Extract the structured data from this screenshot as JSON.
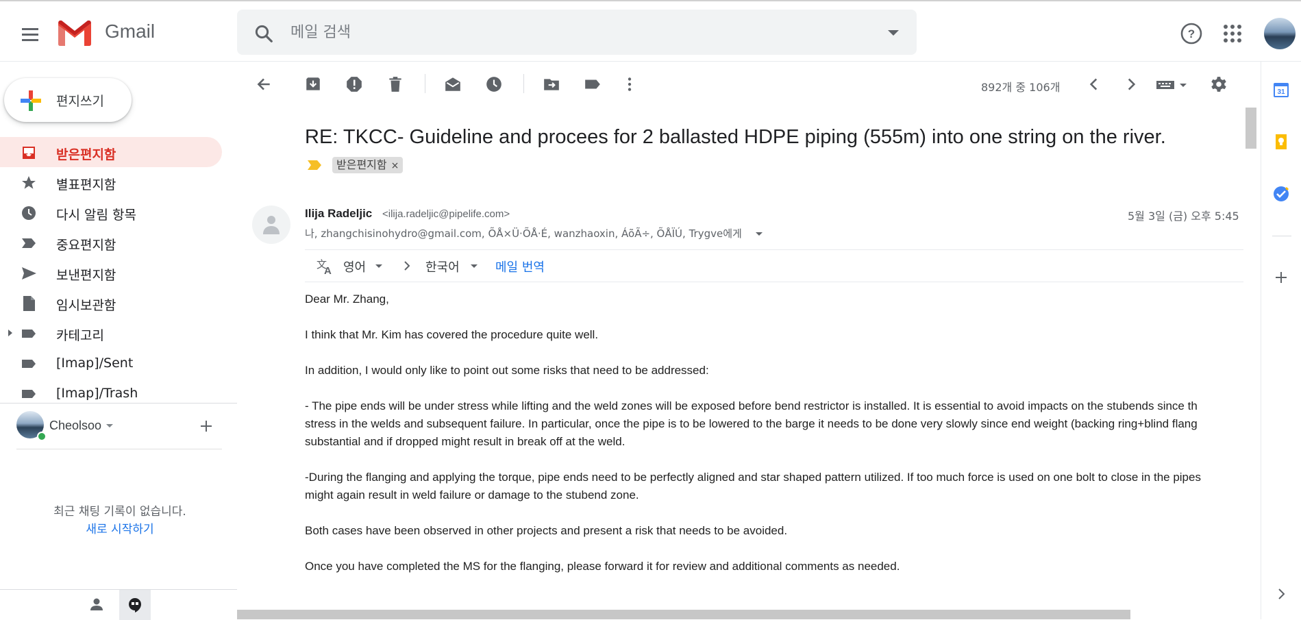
{
  "app": {
    "logo_text": "Gmail"
  },
  "search": {
    "placeholder": "메일 검색"
  },
  "compose": {
    "label": "편지쓰기"
  },
  "nav": {
    "items": [
      {
        "label": "받은편지함",
        "icon": "inbox-icon",
        "active": true
      },
      {
        "label": "별표편지함",
        "icon": "star-icon"
      },
      {
        "label": "다시 알림 항목",
        "icon": "clock-icon"
      },
      {
        "label": "중요편지함",
        "icon": "important-icon"
      },
      {
        "label": "보낸편지함",
        "icon": "send-icon"
      },
      {
        "label": "임시보관함",
        "icon": "draft-icon"
      },
      {
        "label": "카테고리",
        "icon": "label-icon",
        "expandable": true
      },
      {
        "label": "[Imap]/Sent",
        "icon": "label-icon"
      },
      {
        "label": "[Imap]/Trash",
        "icon": "label-icon"
      }
    ]
  },
  "hangouts": {
    "user_name": "Cheolsoo",
    "no_chat_text": "최근 채팅 기록이 없습니다.",
    "start_link": "새로 시작하기"
  },
  "toolbar": {
    "page_count": "892개 중 106개"
  },
  "email": {
    "subject": "RE: TKCC- Guideline and procees for 2 ballasted HDPE piping (555m) into one string on the river.",
    "label_chip": "받은편지함",
    "label_chip_close": "×",
    "sender_name": "Ilija Radeljic",
    "sender_email": "<ilija.radeljic@pipelife.com>",
    "date": "5월 3일 (금) 오후 5:45",
    "recipients": "나, zhangchisinohydro@gmail.com, ÕÅ×Ü·ÕÅ·É, wanzhaoxin, ÁõÃ÷, ÕÅÏÚ, Trygve에게",
    "translate": {
      "from": "영어",
      "to": "한국어",
      "link": "메일 번역"
    },
    "body": [
      "Dear Mr. Zhang,",
      "I think that Mr. Kim has covered the procedure quite well.",
      "In addition, I would only like to point out some risks that need to be addressed:",
      "- The pipe ends will be under stress while lifting and the weld zones will be exposed before bend restrictor is installed. It is essential to avoid impacts on the stubends since th\nstress in the welds and subsequent failure. In particular, once the pipe is to be lowered to the barge it needs to be done very slowly since end weight (backing ring+blind flang\nsubstantial and if dropped might result in break off at the weld.",
      "-During the flanging and applying the torque, pipe ends need to be perfectly aligned and star shaped pattern utilized. If too much force is used on one bolt to close in the pipes\nmight again result in weld failure or damage to the stubend zone.",
      "Both cases have been observed in other projects and present a risk that needs to be avoided.",
      "Once you have completed the MS for the flanging, please forward it for review and additional comments as needed."
    ]
  },
  "colors": {
    "gmail_red": "#d93025",
    "active_bg": "#fce8e6",
    "link_blue": "#1a73e8",
    "online_green": "#34a853"
  }
}
